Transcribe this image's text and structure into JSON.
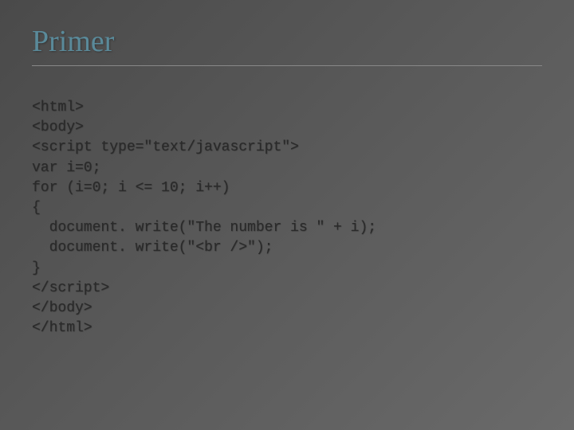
{
  "title": "Primer",
  "code": {
    "lines": [
      {
        "text": "<html>",
        "indent": false
      },
      {
        "text": "<body>",
        "indent": false
      },
      {
        "text": "<script type=\"text/javascript\">",
        "indent": false
      },
      {
        "text": "var i=0;",
        "indent": false
      },
      {
        "text": "for (i=0; i <= 10; i++)",
        "indent": false
      },
      {
        "text": "{",
        "indent": false
      },
      {
        "text": "document. write(\"The number is \" + i);",
        "indent": true
      },
      {
        "text": "document. write(\"<br />\");",
        "indent": true
      },
      {
        "text": "}",
        "indent": false
      },
      {
        "text": "</script>",
        "indent": false
      },
      {
        "text": "</body>",
        "indent": false
      },
      {
        "text": "</html>",
        "indent": false
      }
    ]
  }
}
